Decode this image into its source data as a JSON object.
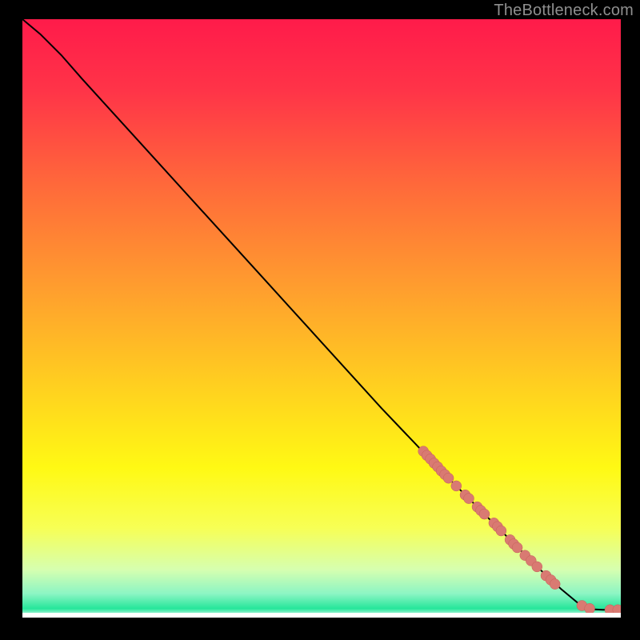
{
  "watermark": "TheBottleneck.com",
  "colors": {
    "frame_bg": "#000000",
    "curve": "#000000",
    "marker_fill": "#d97a72",
    "marker_stroke": "#c46058"
  },
  "chart_data": {
    "type": "line",
    "title": "",
    "xlabel": "",
    "ylabel": "",
    "xlim": [
      0,
      100
    ],
    "ylim": [
      0,
      100
    ],
    "gradient_stops": [
      {
        "offset": 0.0,
        "color": "#ff1b4a"
      },
      {
        "offset": 0.12,
        "color": "#ff3448"
      },
      {
        "offset": 0.28,
        "color": "#ff6a3a"
      },
      {
        "offset": 0.45,
        "color": "#ff9e2e"
      },
      {
        "offset": 0.62,
        "color": "#ffd21f"
      },
      {
        "offset": 0.75,
        "color": "#fff914"
      },
      {
        "offset": 0.85,
        "color": "#f7ff55"
      },
      {
        "offset": 0.92,
        "color": "#d6ffb0"
      },
      {
        "offset": 0.96,
        "color": "#8cf5c4"
      },
      {
        "offset": 0.985,
        "color": "#26e69a"
      },
      {
        "offset": 1.0,
        "color": "#ffffff"
      }
    ],
    "curve_points": [
      {
        "x": 0.0,
        "y": 100.0
      },
      {
        "x": 3.0,
        "y": 97.5
      },
      {
        "x": 6.5,
        "y": 94.0
      },
      {
        "x": 10.0,
        "y": 90.0
      },
      {
        "x": 20.0,
        "y": 79.0
      },
      {
        "x": 30.0,
        "y": 68.0
      },
      {
        "x": 40.0,
        "y": 57.0
      },
      {
        "x": 50.0,
        "y": 46.0
      },
      {
        "x": 60.0,
        "y": 35.0
      },
      {
        "x": 70.0,
        "y": 24.5
      },
      {
        "x": 80.0,
        "y": 14.5
      },
      {
        "x": 86.0,
        "y": 8.5
      },
      {
        "x": 90.0,
        "y": 4.8
      },
      {
        "x": 93.0,
        "y": 2.3
      },
      {
        "x": 95.0,
        "y": 1.4
      },
      {
        "x": 97.0,
        "y": 1.3
      },
      {
        "x": 100.0,
        "y": 1.3
      }
    ],
    "markers": [
      {
        "x": 67.0,
        "y": 27.8
      },
      {
        "x": 67.6,
        "y": 27.1
      },
      {
        "x": 68.2,
        "y": 26.5
      },
      {
        "x": 68.8,
        "y": 25.8
      },
      {
        "x": 69.4,
        "y": 25.2
      },
      {
        "x": 70.0,
        "y": 24.5
      },
      {
        "x": 70.6,
        "y": 23.9
      },
      {
        "x": 71.2,
        "y": 23.3
      },
      {
        "x": 72.5,
        "y": 22.0
      },
      {
        "x": 74.0,
        "y": 20.5
      },
      {
        "x": 74.6,
        "y": 19.9
      },
      {
        "x": 76.0,
        "y": 18.5
      },
      {
        "x": 76.6,
        "y": 17.9
      },
      {
        "x": 77.2,
        "y": 17.3
      },
      {
        "x": 78.8,
        "y": 15.8
      },
      {
        "x": 79.4,
        "y": 15.2
      },
      {
        "x": 80.0,
        "y": 14.5
      },
      {
        "x": 81.5,
        "y": 13.0
      },
      {
        "x": 82.1,
        "y": 12.3
      },
      {
        "x": 82.7,
        "y": 11.7
      },
      {
        "x": 84.0,
        "y": 10.4
      },
      {
        "x": 85.0,
        "y": 9.5
      },
      {
        "x": 86.0,
        "y": 8.5
      },
      {
        "x": 87.5,
        "y": 7.0
      },
      {
        "x": 88.3,
        "y": 6.3
      },
      {
        "x": 89.0,
        "y": 5.6
      },
      {
        "x": 93.5,
        "y": 2.0
      },
      {
        "x": 94.8,
        "y": 1.5
      },
      {
        "x": 98.2,
        "y": 1.3
      },
      {
        "x": 99.5,
        "y": 1.3
      }
    ]
  }
}
